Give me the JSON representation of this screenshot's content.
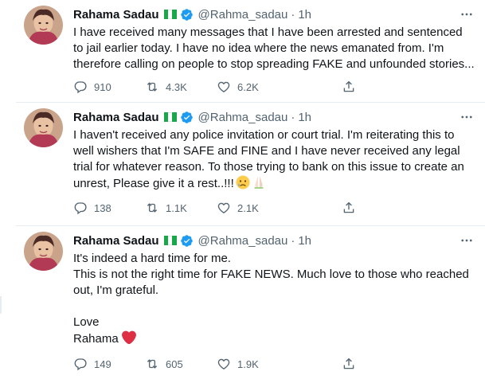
{
  "tweets": [
    {
      "name": "Rahama Sadau",
      "handle": "@Rahma_sadau",
      "separator": "·",
      "time": "1h",
      "text": "I have received many messages that I have been arrested and sentenced to jail earlier today. I have no idea where the news emanated from. I'm therefore calling on people to stop spreading FAKE and unfounded stories...",
      "replies": "910",
      "retweets": "4.3K",
      "likes": "6.2K"
    },
    {
      "name": "Rahama Sadau",
      "handle": "@Rahma_sadau",
      "separator": "·",
      "time": "1h",
      "text": "I haven't received any police invitation or court trial. I'm reiterating this to well wishers that I'm SAFE and FINE and I have never received any legal trial for whatever reason. To those trying to bank on this issue to create an unrest, Please give it a rest..!!!",
      "emoji_after_text": [
        "crying-face-emoji",
        "folded-hands-emoji"
      ],
      "replies": "138",
      "retweets": "1.1K",
      "likes": "2.1K"
    },
    {
      "name": "Rahama Sadau",
      "handle": "@Rahma_sadau",
      "separator": "·",
      "time": "1h",
      "text_lines": [
        "It's indeed a hard time for me.",
        "This is not the right time for FAKE NEWS. Much love to those who reached out, I'm grateful.",
        "",
        "Love",
        "Rahama"
      ],
      "emoji_after_text": [
        "red-heart-emoji"
      ],
      "replies": "149",
      "retweets": "605",
      "likes": "1.9K"
    }
  ],
  "icons": {
    "flag": "nigeria-flag-icon",
    "verified": "verified-badge-icon",
    "more": "more-options-icon",
    "reply": "reply-icon",
    "retweet": "retweet-icon",
    "like": "heart-icon",
    "share": "share-icon"
  },
  "colors": {
    "text": "#0f1419",
    "secondary": "#536471",
    "verified": "#1d9bf0",
    "border": "#e6ecf0",
    "heart": "#e0245e"
  }
}
